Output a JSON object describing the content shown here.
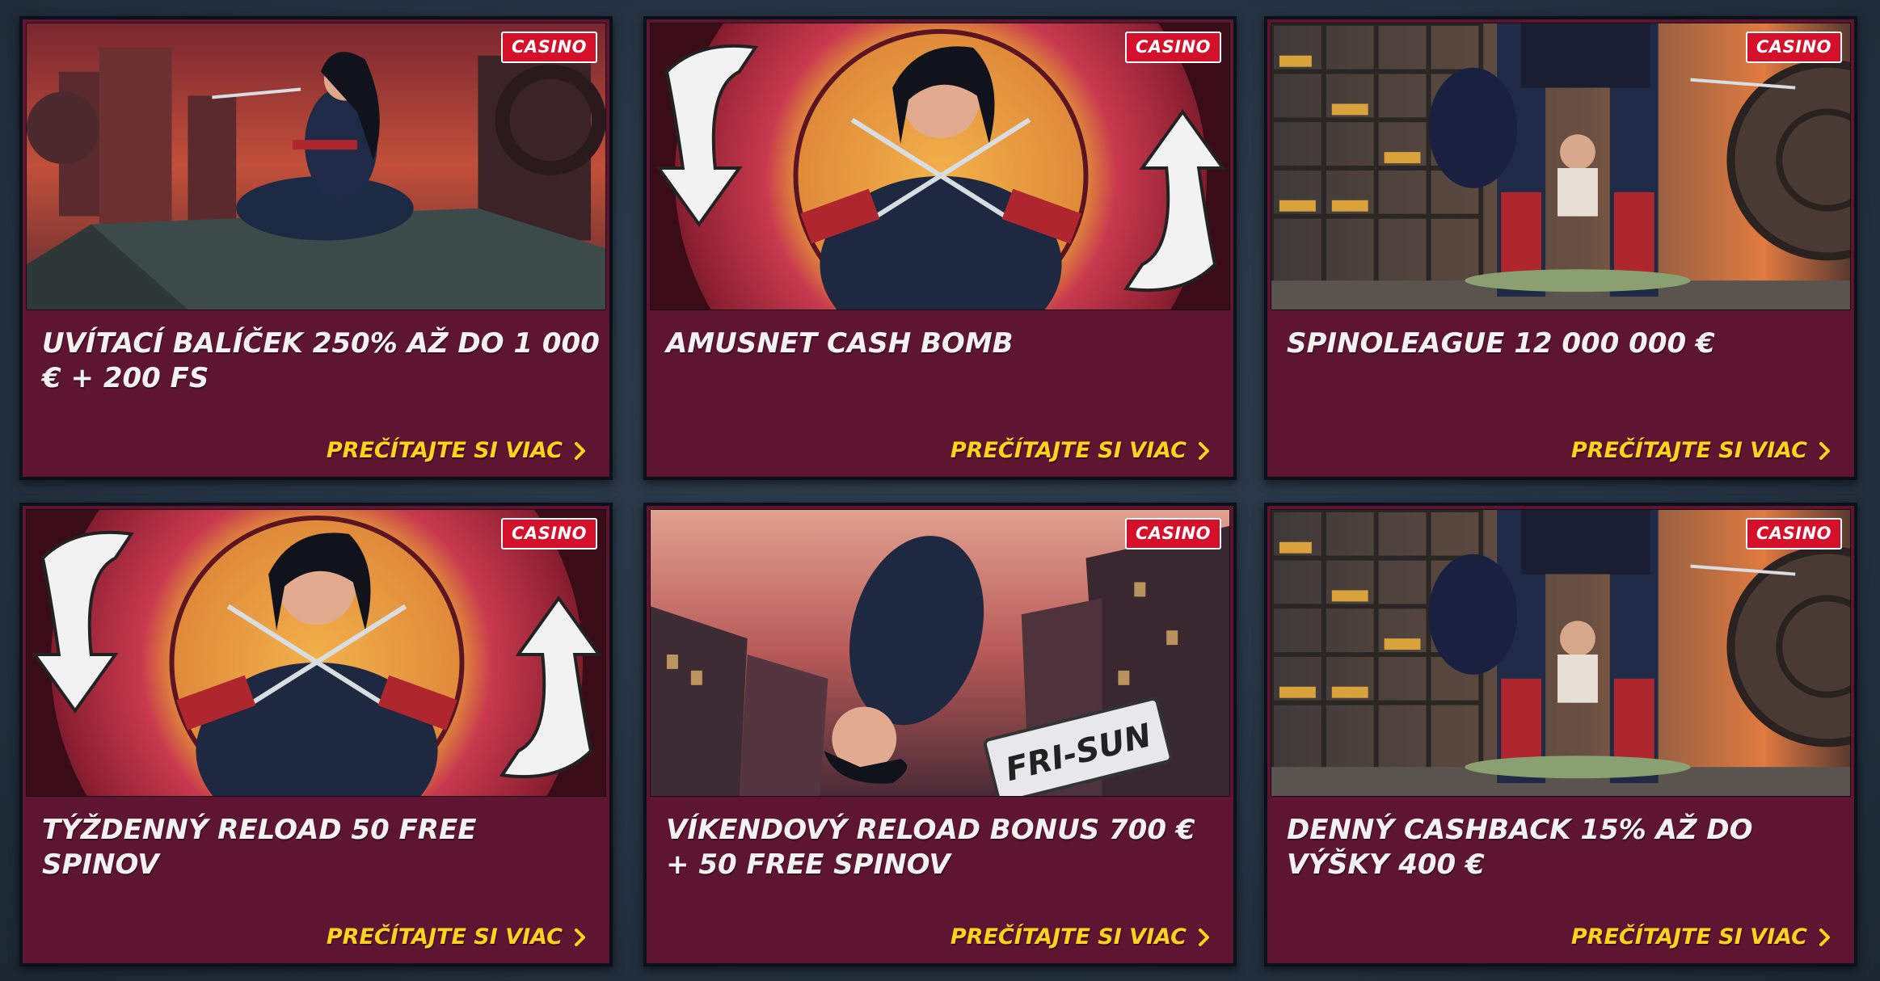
{
  "colors": {
    "card_bg": "#5e1531",
    "badge_bg": "#d4102b",
    "link_color": "#ffd21e",
    "title_color": "#f2f2f2"
  },
  "cards": [
    {
      "badge": "CASINO",
      "title": "UVÍTACÍ BALÍČEK 250% AŽ DO 1 000 € + 200 FS",
      "link": "PREČÍTAJTE SI VIAC",
      "image": "heroine-on-rooftop"
    },
    {
      "badge": "CASINO",
      "title": "AMUSNET CASH BOMB",
      "link": "PREČÍTAJTE SI VIAC",
      "image": "heroine-with-sai-target"
    },
    {
      "badge": "CASINO",
      "title": "SPINOLEAGUE 12 000 000 €",
      "link": "PREČÍTAJTE SI VIAC",
      "image": "vault-gold-bars"
    },
    {
      "badge": "CASINO",
      "title": "TÝŽDENNÝ RELOAD 50 FREE SPINOV",
      "link": "PREČÍTAJTE SI VIAC",
      "image": "heroine-with-sai-target"
    },
    {
      "badge": "CASINO",
      "title": "VÍKENDOVÝ RELOAD BONUS 700 € + 50 FREE SPINOV",
      "link": "PREČÍTAJTE SI VIAC",
      "image": "heroine-falling-fri-sun",
      "sign_text": "FRI-SUN"
    },
    {
      "badge": "CASINO",
      "title": "DENNÝ CASHBACK 15% AŽ DO VÝŠKY 400 €",
      "link": "PREČÍTAJTE SI VIAC",
      "image": "vault-gold-bars"
    }
  ]
}
